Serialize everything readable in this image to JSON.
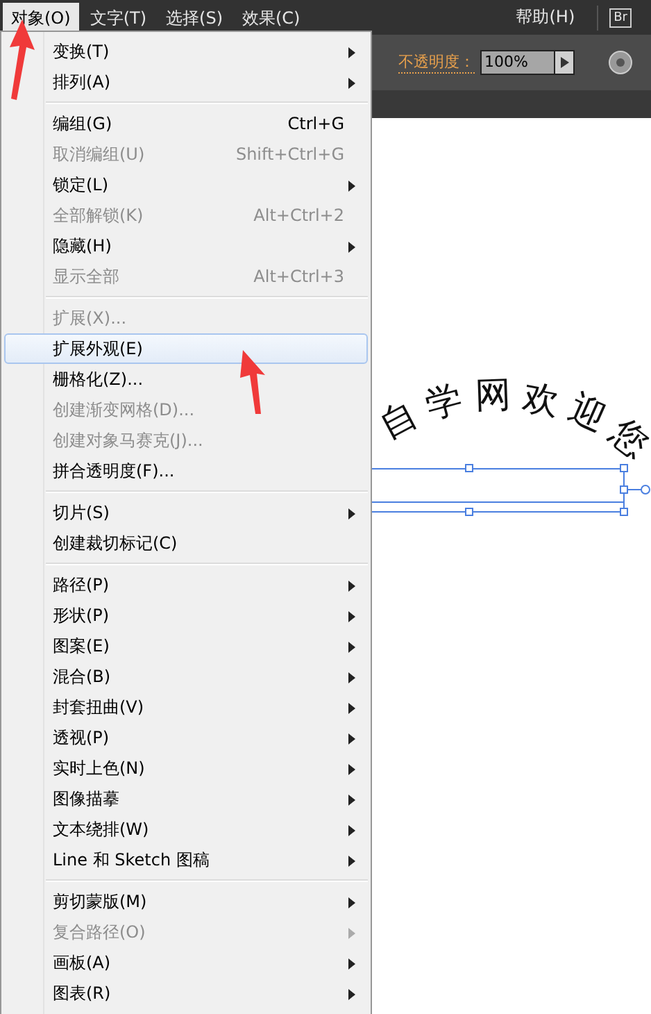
{
  "menubar": {
    "items": [
      {
        "label": "对象(O)",
        "selected": true
      },
      {
        "label": "文字(T)",
        "selected": false
      },
      {
        "label": "选择(S)",
        "selected": false
      },
      {
        "label": "效果(C)",
        "selected": false
      }
    ],
    "help": "帮助(H)",
    "bridge": "Br"
  },
  "toolbar": {
    "opacity_label": "不透明度：",
    "opacity_value": "100%"
  },
  "canvas": {
    "arc_text": "自学网欢迎您"
  },
  "menu": {
    "groups": [
      [
        {
          "label": "变换(T)",
          "submenu": true,
          "disabled": false,
          "selected": false
        },
        {
          "label": "排列(A)",
          "submenu": true,
          "disabled": false,
          "selected": false
        }
      ],
      [
        {
          "label": "编组(G)",
          "shortcut": "Ctrl+G",
          "submenu": false,
          "disabled": false,
          "selected": false
        },
        {
          "label": "取消编组(U)",
          "shortcut": "Shift+Ctrl+G",
          "submenu": false,
          "disabled": true,
          "selected": false
        },
        {
          "label": "锁定(L)",
          "submenu": true,
          "disabled": false,
          "selected": false
        },
        {
          "label": "全部解锁(K)",
          "shortcut": "Alt+Ctrl+2",
          "submenu": false,
          "disabled": true,
          "selected": false
        },
        {
          "label": "隐藏(H)",
          "submenu": true,
          "disabled": false,
          "selected": false
        },
        {
          "label": "显示全部",
          "shortcut": "Alt+Ctrl+3",
          "submenu": false,
          "disabled": true,
          "selected": false
        }
      ],
      [
        {
          "label": "扩展(X)...",
          "submenu": false,
          "disabled": true,
          "selected": false
        },
        {
          "label": "扩展外观(E)",
          "submenu": false,
          "disabled": false,
          "selected": true
        },
        {
          "label": "栅格化(Z)...",
          "submenu": false,
          "disabled": false,
          "selected": false
        },
        {
          "label": "创建渐变网格(D)...",
          "submenu": false,
          "disabled": true,
          "selected": false
        },
        {
          "label": "创建对象马赛克(J)...",
          "submenu": false,
          "disabled": true,
          "selected": false
        },
        {
          "label": "拼合透明度(F)...",
          "submenu": false,
          "disabled": false,
          "selected": false
        }
      ],
      [
        {
          "label": "切片(S)",
          "submenu": true,
          "disabled": false,
          "selected": false
        },
        {
          "label": "创建裁切标记(C)",
          "submenu": false,
          "disabled": false,
          "selected": false
        }
      ],
      [
        {
          "label": "路径(P)",
          "submenu": true,
          "disabled": false,
          "selected": false
        },
        {
          "label": "形状(P)",
          "submenu": true,
          "disabled": false,
          "selected": false
        },
        {
          "label": "图案(E)",
          "submenu": true,
          "disabled": false,
          "selected": false
        },
        {
          "label": "混合(B)",
          "submenu": true,
          "disabled": false,
          "selected": false
        },
        {
          "label": "封套扭曲(V)",
          "submenu": true,
          "disabled": false,
          "selected": false
        },
        {
          "label": "透视(P)",
          "submenu": true,
          "disabled": false,
          "selected": false
        },
        {
          "label": "实时上色(N)",
          "submenu": true,
          "disabled": false,
          "selected": false
        },
        {
          "label": "图像描摹",
          "submenu": true,
          "disabled": false,
          "selected": false
        },
        {
          "label": "文本绕排(W)",
          "submenu": true,
          "disabled": false,
          "selected": false
        },
        {
          "label": "Line 和 Sketch 图稿",
          "submenu": true,
          "disabled": false,
          "selected": false
        }
      ],
      [
        {
          "label": "剪切蒙版(M)",
          "submenu": true,
          "disabled": false,
          "selected": false
        },
        {
          "label": "复合路径(O)",
          "submenu": true,
          "disabled": true,
          "selected": false
        },
        {
          "label": "画板(A)",
          "submenu": true,
          "disabled": false,
          "selected": false
        },
        {
          "label": "图表(R)",
          "submenu": true,
          "disabled": false,
          "selected": false
        }
      ]
    ]
  }
}
